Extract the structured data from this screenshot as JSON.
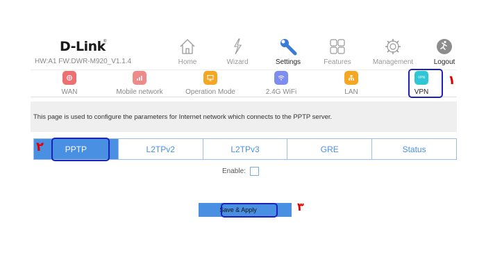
{
  "header": {
    "brand": "D-Link",
    "brand_reg": "®",
    "hw_info": "HW:A1 FW:DWR-M920_V1.1.4"
  },
  "top_nav": [
    {
      "label": "Home",
      "icon": "house-icon"
    },
    {
      "label": "Wizard",
      "icon": "wand-icon"
    },
    {
      "label": "Settings",
      "icon": "wrench-icon",
      "active": true
    },
    {
      "label": "Features",
      "icon": "grid-icon"
    },
    {
      "label": "Management",
      "icon": "gear-icon"
    },
    {
      "label": "Logout",
      "icon": "logout-icon"
    }
  ],
  "sub_nav": [
    {
      "label": "WAN",
      "icon": "wan-icon",
      "color": "#ee6f6f"
    },
    {
      "label": "Mobile network",
      "icon": "signal-icon",
      "color": "#ee8a8a"
    },
    {
      "label": "Operation Mode",
      "icon": "monitor-icon",
      "color": "#f5a623"
    },
    {
      "label": "2.4G WiFi",
      "icon": "wifi-icon",
      "color": "#7d8ef0"
    },
    {
      "label": "LAN",
      "icon": "lan-icon",
      "color": "#f5a623"
    },
    {
      "label": "VPN",
      "icon": "vpn-icon",
      "color": "#2fc6d6",
      "icon_text": "VPN",
      "active": true
    }
  ],
  "description": "This page is used to configure the parameters for Internet network which connects to the PPTP server.",
  "tabs": [
    {
      "label": "PPTP",
      "active": true
    },
    {
      "label": "L2TPv2"
    },
    {
      "label": "L2TPv3"
    },
    {
      "label": "GRE"
    },
    {
      "label": "Status"
    }
  ],
  "enable_label": "Enable:",
  "enable_checked": false,
  "save_button": "Save & Apply",
  "annotations": {
    "marker_1": "١",
    "marker_2": "٢",
    "marker_3": "٣",
    "highlight_color": "#1a22b8",
    "marker_color": "#e00000"
  },
  "colors": {
    "accent": "#4a90e2",
    "icon_gray": "#9a9a9a",
    "active_icon": "#3a7bd5"
  }
}
